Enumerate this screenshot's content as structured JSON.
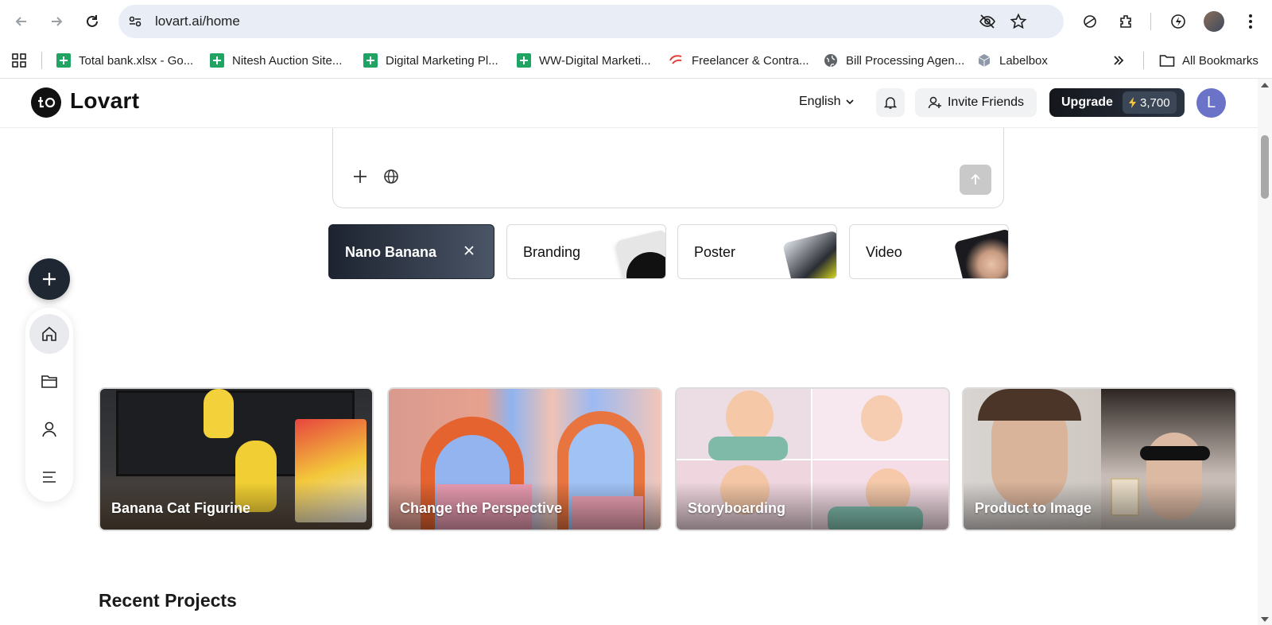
{
  "browser": {
    "url": "lovart.ai/home",
    "bookmarks": [
      {
        "label": "Total bank.xlsx - Go...",
        "icon": "sheets-icon"
      },
      {
        "label": "Nitesh Auction Site...",
        "icon": "sheets-icon"
      },
      {
        "label": "Digital Marketing Pl...",
        "icon": "sheets-icon"
      },
      {
        "label": "WW-Digital Marketi...",
        "icon": "sheets-icon"
      },
      {
        "label": "Freelancer & Contra...",
        "icon": "freelancer-icon"
      },
      {
        "label": "Bill Processing Agen...",
        "icon": "globe-icon"
      },
      {
        "label": "Labelbox",
        "icon": "labelbox-icon"
      }
    ],
    "all_bookmarks": "All Bookmarks"
  },
  "header": {
    "brand": "Lovart",
    "language": "English",
    "invite_label": "Invite Friends",
    "upgrade_label": "Upgrade",
    "credits": "3,700",
    "avatar_initial": "L"
  },
  "chips": [
    {
      "label": "Nano Banana",
      "active": true
    },
    {
      "label": "Branding",
      "active": false
    },
    {
      "label": "Poster",
      "active": false
    },
    {
      "label": "Video",
      "active": false
    }
  ],
  "templates": [
    {
      "label": "Banana Cat Figurine"
    },
    {
      "label": "Change the Perspective"
    },
    {
      "label": "Storyboarding"
    },
    {
      "label": "Product to Image"
    }
  ],
  "recent_projects_title": "Recent Projects",
  "colors": {
    "accent_dark": "#1f2733",
    "sheets_green": "#1fa463",
    "avatar": "#6b73c9"
  }
}
